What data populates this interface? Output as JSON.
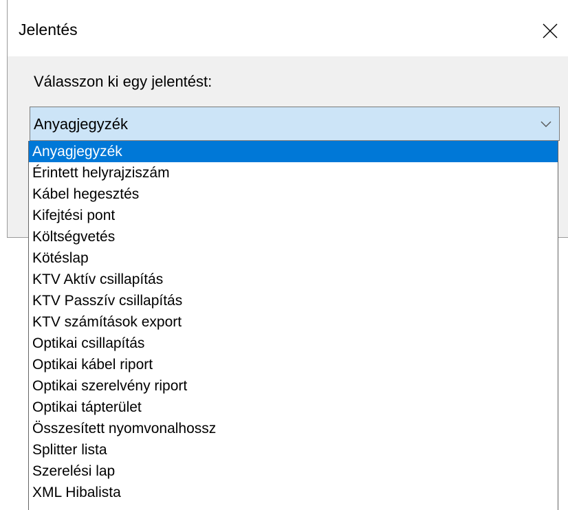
{
  "dialog": {
    "title": "Jelentés",
    "close_icon": "close-icon",
    "prompt": "Válasszon ki egy jelentést:"
  },
  "combo": {
    "selected_value": "Anyagjegyzék",
    "arrow_icon": "chevron-down-icon"
  },
  "colors": {
    "selection": "#0078d7",
    "combo_background": "#cce4f7",
    "dialog_background": "#f0f0f0"
  },
  "dropdown": {
    "selected_index": 0,
    "items": [
      "Anyagjegyzék",
      "Érintett helyrajziszám",
      "Kábel hegesztés",
      "Kifejtési pont",
      "Költségvetés",
      "Kötéslap",
      "KTV Aktív csillapítás",
      "KTV Passzív csillapítás",
      "KTV számítások export",
      "Optikai csillapítás",
      "Optikai kábel riport",
      "Optikai szerelvény riport",
      "Optikai tápterület",
      "Összesített nyomvonalhossz",
      "Splitter lista",
      "Szerelési lap",
      "XML Hibalista"
    ]
  }
}
